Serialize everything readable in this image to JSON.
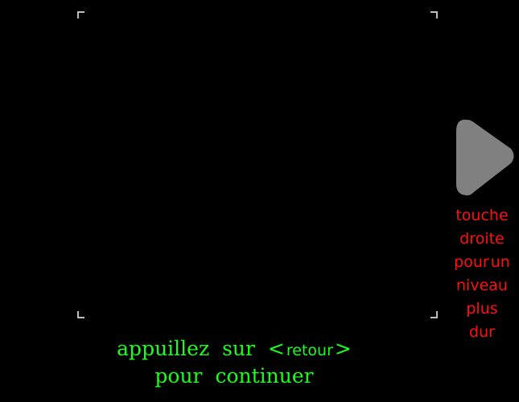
{
  "instruction": {
    "line1": {
      "word1": "appuillez",
      "word2": "sur",
      "key_open": "<",
      "key_name": "retour",
      "key_close": ">"
    },
    "line2": {
      "word1": "pour",
      "word2": "continuer"
    }
  },
  "next_level": {
    "icon": "play-arrow-icon",
    "hint": {
      "line1": "touche",
      "line2": "droite",
      "line3a": "pour",
      "line3b": "un",
      "line4": "niveau",
      "line5": "plus",
      "line6": "dur"
    }
  },
  "colors": {
    "background": "#000000",
    "instruction_text": "#19ff19",
    "hint_text": "#ff1010",
    "arrow": "#808080",
    "frame": "#bdbdbd"
  }
}
